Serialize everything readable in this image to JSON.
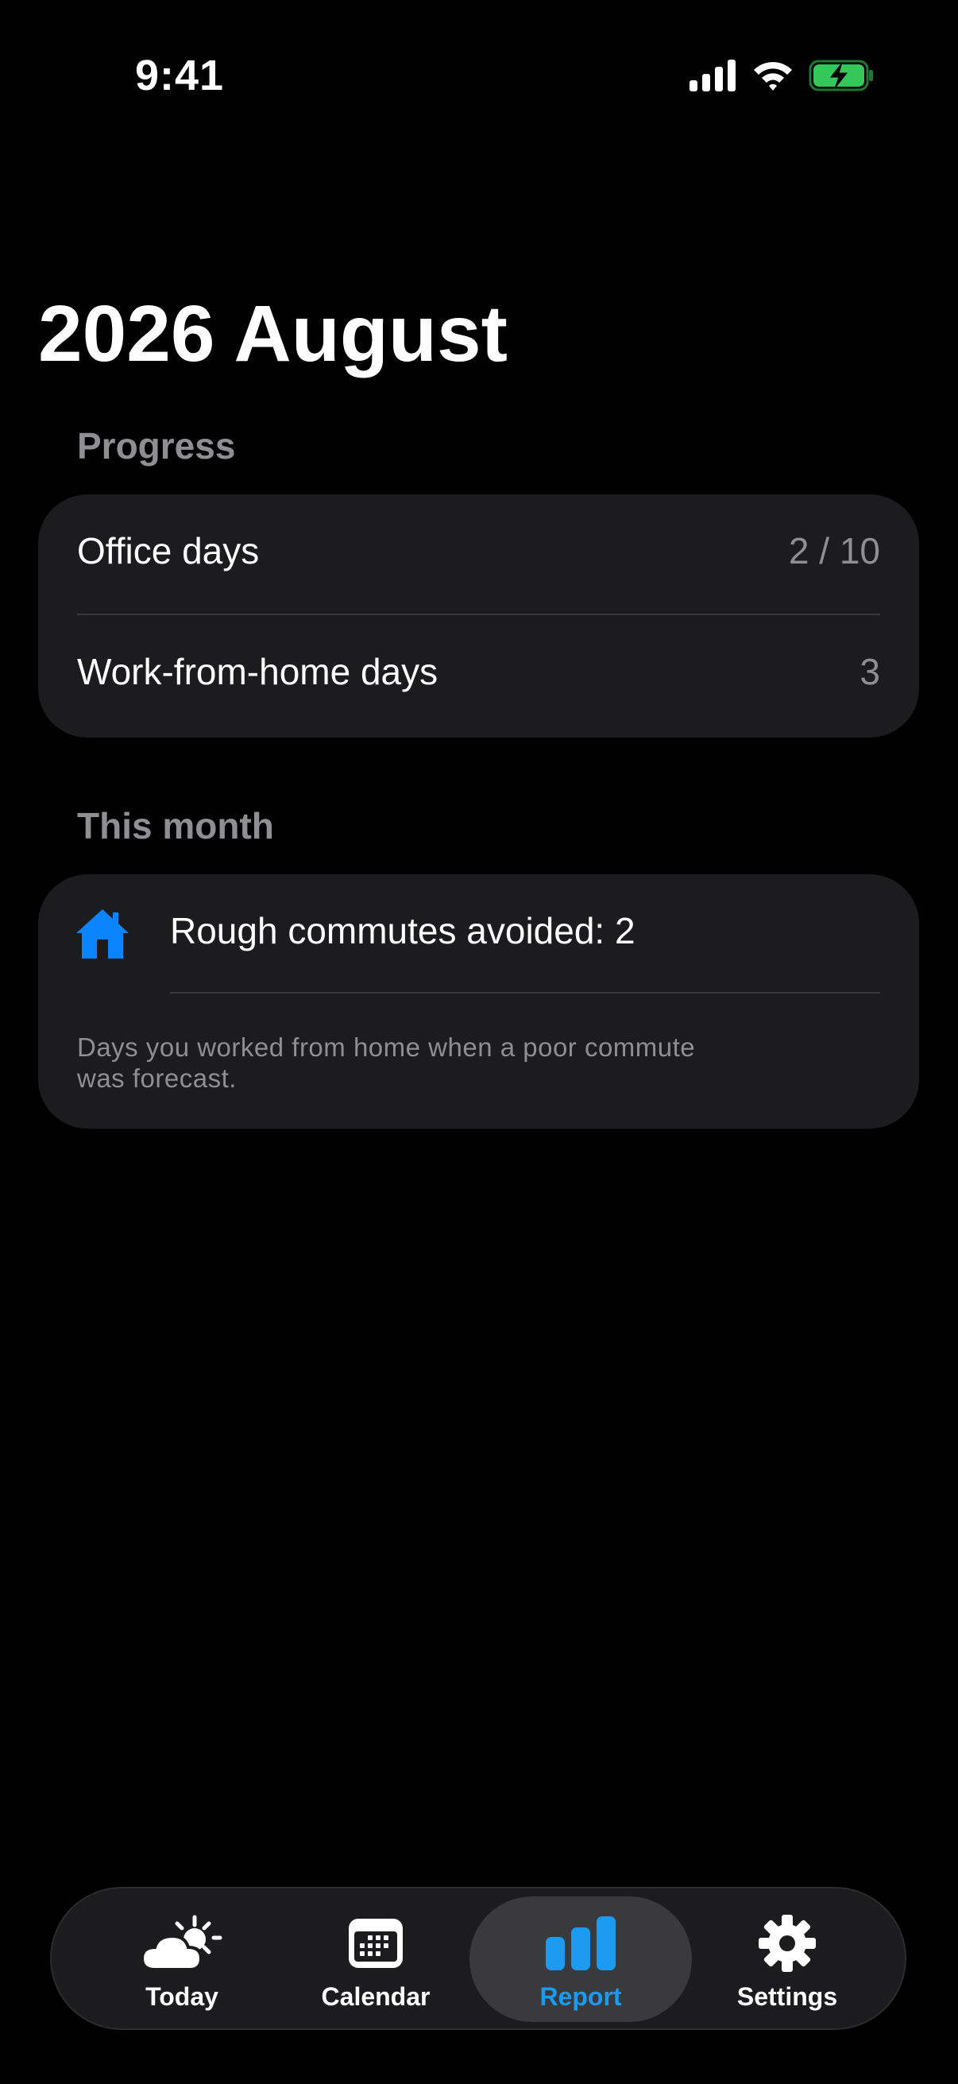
{
  "status_bar": {
    "time": "9:41",
    "icons": [
      "signal-icon",
      "wifi-icon",
      "battery-charging-icon"
    ]
  },
  "title": "2026 August",
  "progress": {
    "header": "Progress",
    "rows": [
      {
        "label": "Office days",
        "value": "2 / 10"
      },
      {
        "label": "Work-from-home days",
        "value": "3"
      }
    ]
  },
  "this_month": {
    "header": "This month",
    "icon": "house-icon",
    "label": "Rough commutes avoided: 2",
    "footnote": "Days you worked from home when a poor commute was forecast."
  },
  "tab_bar": {
    "tabs": [
      {
        "label": "Today",
        "icon": "weather-icon",
        "active": false
      },
      {
        "label": "Calendar",
        "icon": "calendar-icon",
        "active": false
      },
      {
        "label": "Report",
        "icon": "bar-chart-icon",
        "active": true
      },
      {
        "label": "Settings",
        "icon": "gear-icon",
        "active": false
      }
    ]
  },
  "colors": {
    "background": "#000000",
    "card": "#1c1c1e",
    "secondary_text": "#8e8e93",
    "accent": "#1a9bf0",
    "house_icon": "#0a84ff",
    "battery": "#34c759"
  }
}
